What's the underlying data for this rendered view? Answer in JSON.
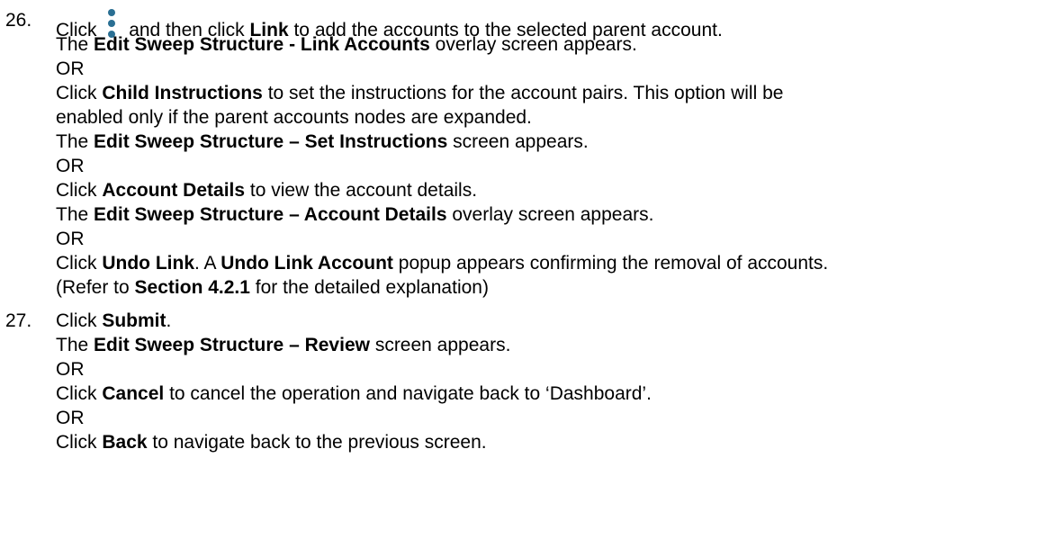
{
  "step26": {
    "number": "26.",
    "line1": {
      "t1": "Click",
      "t2": "and then click",
      "b1": "Link",
      "t3": "to add the accounts to the selected parent account."
    },
    "line2": {
      "t1": "The",
      "b1": "Edit Sweep Structure - Link Accounts",
      "t2": "overlay screen appears."
    },
    "or1": "OR",
    "line4": {
      "t1": "Click",
      "b1": "Child Instructions",
      "t2": "to set the instructions for the account pairs. This option will be"
    },
    "line5": "enabled only if the parent accounts nodes are expanded.",
    "line6": {
      "t1": "The",
      "b1": "Edit Sweep Structure – Set Instructions",
      "t2": "screen appears."
    },
    "or2": "OR",
    "line8": {
      "t1": "Click",
      "b1": "Account Details",
      "t2": "to view the account details."
    },
    "line9": {
      "t1": "The",
      "b1": "Edit Sweep Structure – Account Details",
      "t2": "overlay screen appears."
    },
    "or3": "OR",
    "line11": {
      "t1": "Click",
      "b1": "Undo Link",
      "t2": ". A",
      "b2": "Undo Link Account",
      "t3": "popup appears confirming the removal of accounts."
    },
    "line12": {
      "t1": "(Refer to",
      "b1": "Section 4.2.1",
      "t2": "for the detailed explanation)"
    }
  },
  "step27": {
    "number": "27.",
    "line1": {
      "t1": "Click",
      "b1": "Submit",
      "t2": "."
    },
    "line2": {
      "t1": "The",
      "b1": "Edit Sweep Structure – Review",
      "t2": "screen appears."
    },
    "or1": "OR",
    "line4": {
      "t1": "Click",
      "b1": "Cancel",
      "t2": "to cancel the operation and navigate back to ‘Dashboard’."
    },
    "or2": "OR",
    "line6": {
      "t1": "Click",
      "b1": "Back",
      "t2": "to navigate back to the previous screen."
    }
  },
  "icons": {
    "kebab_menu": "vertical-ellipsis-icon",
    "kebab_color": "#2a6f93"
  }
}
